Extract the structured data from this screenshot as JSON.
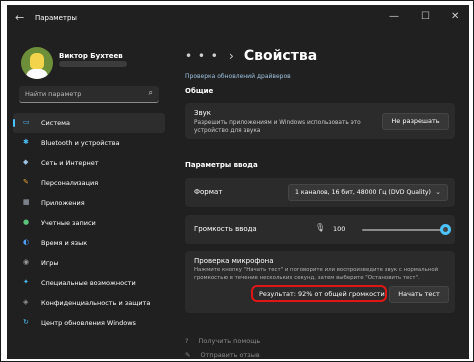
{
  "window": {
    "back_glyph": "←",
    "title": "Параметры",
    "controls": {
      "minimize": "—",
      "maximize": "☐",
      "close": "✕"
    }
  },
  "user": {
    "name": "Виктор Бухтеев"
  },
  "search": {
    "placeholder": "Найти параметр",
    "icon": "search-icon",
    "glyph": "⌕"
  },
  "sidebar": {
    "items": [
      {
        "label": "Система",
        "icon": "monitor-icon",
        "glyph": "▭",
        "color": "#4cc2ff",
        "active": true
      },
      {
        "label": "Bluetooth и устройства",
        "icon": "bluetooth-icon",
        "glyph": "✱",
        "color": "#4cc2ff"
      },
      {
        "label": "Сеть и Интернет",
        "icon": "network-icon",
        "glyph": "◆",
        "color": "#9fc3e0"
      },
      {
        "label": "Персонализация",
        "icon": "brush-icon",
        "glyph": "✎",
        "color": "#e8a23a"
      },
      {
        "label": "Приложения",
        "icon": "apps-icon",
        "glyph": "▦",
        "color": "#b0b8c8"
      },
      {
        "label": "Учетные записи",
        "icon": "person-icon",
        "glyph": "●",
        "color": "#5ac47a"
      },
      {
        "label": "Время и язык",
        "icon": "globe-icon",
        "glyph": "◐",
        "color": "#4c9fff"
      },
      {
        "label": "Игры",
        "icon": "gamepad-icon",
        "glyph": "◉",
        "color": "#9a9a9a"
      },
      {
        "label": "Специальные возможности",
        "icon": "accessibility-icon",
        "glyph": "✦",
        "color": "#4cc2ff"
      },
      {
        "label": "Конфиденциальность и защита",
        "icon": "shield-icon",
        "glyph": "◈",
        "color": "#9a9a9a"
      },
      {
        "label": "Центр обновления Windows",
        "icon": "update-icon",
        "glyph": "↻",
        "color": "#4cc2ff"
      }
    ]
  },
  "main": {
    "breadcrumb": {
      "dots": "• • •",
      "sep": "›",
      "current": "Свойства"
    },
    "driver_link": "Проверка обновлений драйверов",
    "general": {
      "header": "Общие",
      "sound": {
        "title": "Звук",
        "desc_line1": "Разрешить приложениям и Windows использовать это",
        "desc_line2": "устройство для звука",
        "button": "Не разрешать"
      }
    },
    "input": {
      "header": "Параметры ввода",
      "format": {
        "label": "Формат",
        "value": "1 каналов, 16 бит, 48000 Гц (DVD Quality)",
        "chevron": "⌄"
      },
      "volume": {
        "label": "Громкость ввода",
        "value": "100",
        "level_percent": 100,
        "mic_icon": "microphone-icon",
        "mic_glyph": "🎙"
      },
      "mic_test": {
        "title": "Проверка микрофона",
        "desc_line1": "Нажмите кнопку \"Начать тест\" и поговорите или воспроизведите звук с нормальной",
        "desc_line2": "громкостью в течение нескольких секунд, затем выберите \"Остановить тест\".",
        "result": "Результат: 92% от общей громкости",
        "button": "Начать тест"
      }
    },
    "help": {
      "label": "Получить помощь",
      "glyph": "?"
    },
    "feedback": {
      "label": "Отправить отзыв",
      "glyph": "✎"
    }
  },
  "colors": {
    "accent": "#4cc2ff",
    "highlight": "#e01515",
    "bg": "#202020",
    "card": "#2b2b2b"
  }
}
